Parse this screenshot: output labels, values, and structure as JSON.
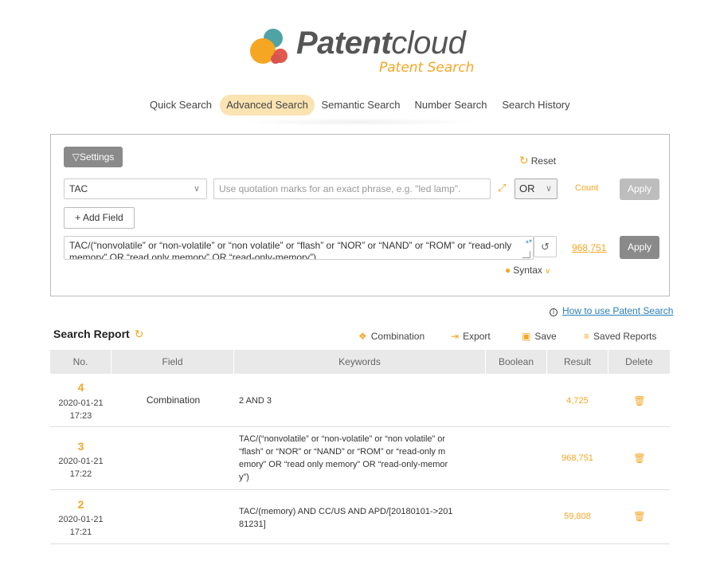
{
  "brand": {
    "name_bold": "Patent",
    "name_light": "cloud",
    "subtitle": "Patent Search",
    "colors": {
      "orange": "#f5a623",
      "teal": "#4fa3a5",
      "red": "#e05a4f",
      "gray": "#555555"
    }
  },
  "nav": {
    "items": [
      {
        "label": "Quick Search",
        "active": false
      },
      {
        "label": "Advanced Search",
        "active": true
      },
      {
        "label": "Semantic Search",
        "active": false
      },
      {
        "label": "Number Search",
        "active": false
      },
      {
        "label": "Search History",
        "active": false
      }
    ]
  },
  "search": {
    "settings_label": "Settings",
    "reset_label": "Reset",
    "field_value": "TAC",
    "keyword_placeholder": "Use quotation marks for an exact phrase, e.g. \"led lamp\".",
    "boolean_value": "OR",
    "count_label": "Count",
    "apply_label": "Apply",
    "add_field_label": "Add Field",
    "query_line1": "TAC/(“nonvolatile” or “non-volatile” or “non volatile” or “flash” or “NOR” or “NAND” or “ROM” or “read-only",
    "query_line2": "memory” OR “read only memory” OR “read-only-memory”)",
    "result_count": "968,751",
    "apply_label_2": "Apply",
    "syntax_label": "Syntax"
  },
  "help": {
    "howto_label": "How to use Patent Search"
  },
  "report": {
    "title": "Search Report",
    "tools": {
      "combination": "Combination",
      "export": "Export",
      "save": "Save",
      "saved_reports": "Saved Reports"
    },
    "columns": [
      "No.",
      "Field",
      "Keywords",
      "Boolean",
      "Result",
      "Delete"
    ],
    "rows": [
      {
        "no": "4",
        "date": "2020-01-21",
        "time": "17:23",
        "field": "Combination",
        "keywords": [
          "2 AND 3"
        ],
        "boolean": "",
        "result": "4,725"
      },
      {
        "no": "3",
        "date": "2020-01-21",
        "time": "17:22",
        "field": "",
        "keywords": [
          "TAC/(“nonvolatile” or “non-volatile” or “non volatile” or",
          "“flash” or “NOR” or “NAND” or “ROM” or “read-only m",
          "emory” OR “read only memory” OR “read-only-memor",
          "y”)"
        ],
        "boolean": "",
        "result": "968,751"
      },
      {
        "no": "2",
        "date": "2020-01-21",
        "time": "17:21",
        "field": "",
        "keywords": [
          "TAC/(memory) AND CC/US AND APD/[20180101->201",
          "81231]"
        ],
        "boolean": "",
        "result": "59,808"
      }
    ]
  }
}
